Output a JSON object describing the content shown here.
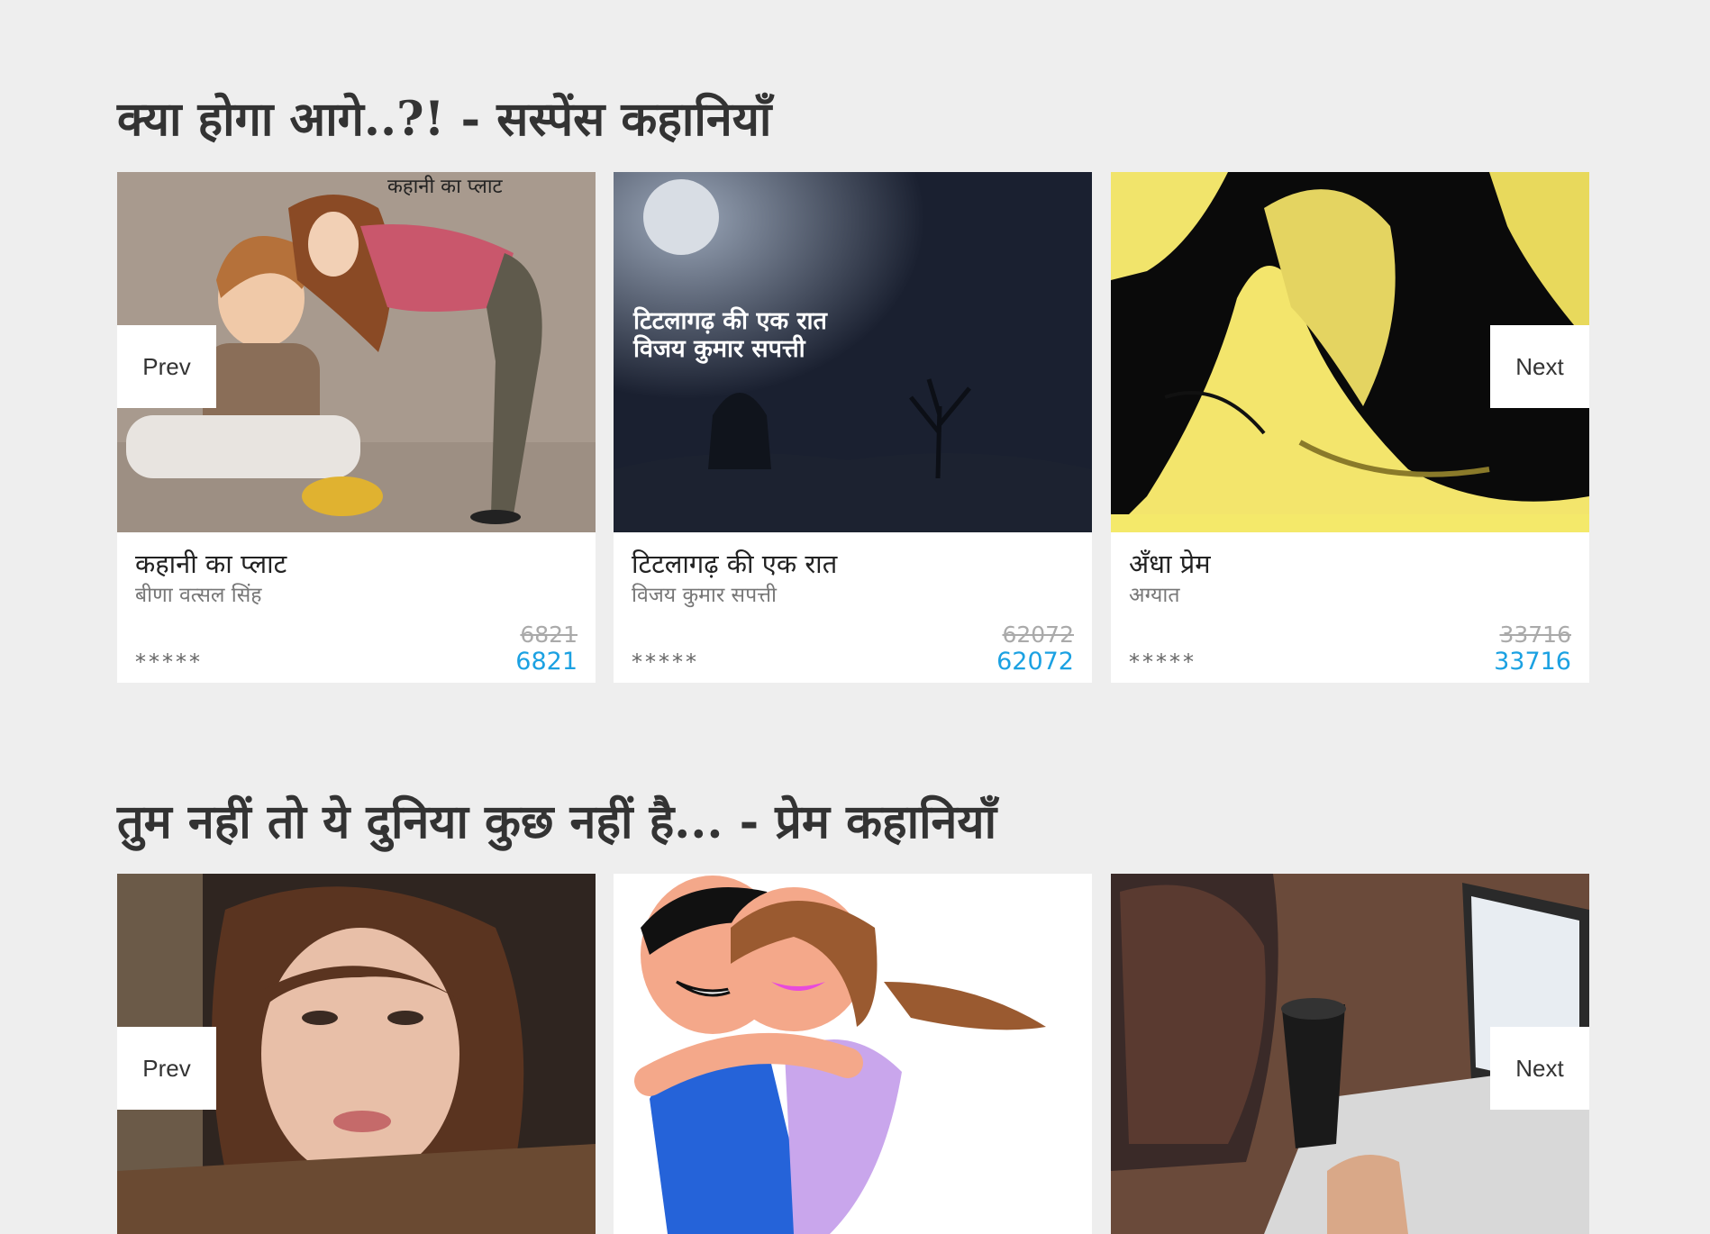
{
  "sections": [
    {
      "title": "क्या होगा आगे..?! - सस्पेंस कहानियाँ",
      "prev_label": "Prev",
      "next_label": "Next",
      "cards": [
        {
          "title": "कहानी का प्लाट",
          "author": "बीणा वत्सल सिंह",
          "cover_text": "कहानी का प्लाट",
          "rating_text": "*****",
          "old_count": "6821",
          "count": "6821"
        },
        {
          "title": "टिटलागढ़ की एक रात",
          "author": "विजय कुमार सपत्ती",
          "cover_line1": "टिटलागढ़ की एक रात",
          "cover_line2": "विजय कुमार सपत्ती",
          "rating_text": "*****",
          "old_count": "62072",
          "count": "62072"
        },
        {
          "title": "अँधा प्रेम",
          "author": "अग्यात",
          "rating_text": "*****",
          "old_count": "33716",
          "count": "33716"
        }
      ]
    },
    {
      "title": "तुम नहीं तो ये दुनिया कुछ नहीं है... - प्रेम कहानियाँ",
      "prev_label": "Prev",
      "next_label": "Next"
    }
  ],
  "colors": {
    "background": "#eeeeee",
    "count_accent": "#1ba1e2",
    "old_count": "#aaaaaa"
  }
}
